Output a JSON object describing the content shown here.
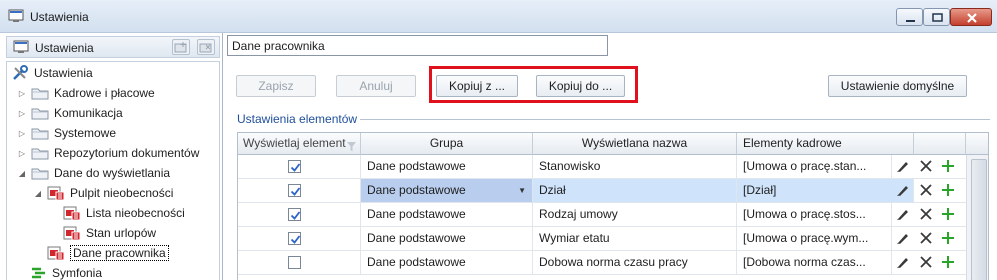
{
  "window": {
    "title": "Ustawienia"
  },
  "left_panel": {
    "header_label": "Ustawienia",
    "tree": [
      {
        "label": "Ustawienia",
        "level": 0,
        "icon": "tools-icon",
        "expander": ""
      },
      {
        "label": "Kadrowe i płacowe",
        "level": 1,
        "icon": "folder-icon",
        "expander": "▷"
      },
      {
        "label": "Komunikacja",
        "level": 1,
        "icon": "folder-icon",
        "expander": "▷"
      },
      {
        "label": "Systemowe",
        "level": 1,
        "icon": "folder-icon",
        "expander": "▷"
      },
      {
        "label": "Repozytorium dokumentów",
        "level": 1,
        "icon": "folder-icon",
        "expander": "▷"
      },
      {
        "label": "Dane do wyświetlania",
        "level": 1,
        "icon": "folder-icon",
        "expander": "◢"
      },
      {
        "label": "Pulpit nieobecności",
        "level": 2,
        "icon": "settings-page-icon",
        "expander": "◢"
      },
      {
        "label": "Lista nieobecności",
        "level": 3,
        "icon": "settings-page-icon",
        "expander": ""
      },
      {
        "label": "Stan urlopów",
        "level": 3,
        "icon": "settings-page-icon",
        "expander": ""
      },
      {
        "label": "Dane pracownika",
        "level": 2,
        "icon": "settings-page-icon",
        "expander": "",
        "selected": true
      },
      {
        "label": "Symfonia",
        "level": 1,
        "icon": "symfonia-icon",
        "expander": ""
      }
    ]
  },
  "editor": {
    "name_value": "Dane pracownika",
    "buttons": {
      "save": "Zapisz",
      "cancel": "Anuluj",
      "copy_from": "Kopiuj z ...",
      "copy_to": "Kopiuj do ...",
      "default": "Ustawienie domyślne"
    },
    "section_title": "Ustawienia elementów",
    "columns": [
      "Wyświetlaj element",
      "Grupa",
      "Wyświetlana nazwa",
      "Elementy kadrowe"
    ],
    "rows": [
      {
        "checked": true,
        "group": "Dane podstawowe",
        "name": "Stanowisko",
        "elements": "[Umowa o pracę.stan..."
      },
      {
        "checked": true,
        "group": "Dane podstawowe",
        "name": "Dział",
        "elements": "[Dział]",
        "selected": true
      },
      {
        "checked": true,
        "group": "Dane podstawowe",
        "name": "Rodzaj umowy",
        "elements": "[Umowa o pracę.stos..."
      },
      {
        "checked": true,
        "group": "Dane podstawowe",
        "name": "Wymiar etatu",
        "elements": "[Umowa o pracę.wym..."
      },
      {
        "checked": false,
        "group": "Dane podstawowe",
        "name": "Dobowa norma czasu pracy",
        "elements": "[Dobowa norma czas..."
      }
    ]
  },
  "colors": {
    "accent": "#1f4f9a",
    "highlight_border": "#e0101c",
    "selected_row": "#cfe3fa",
    "add_icon": "#2aa52a"
  }
}
